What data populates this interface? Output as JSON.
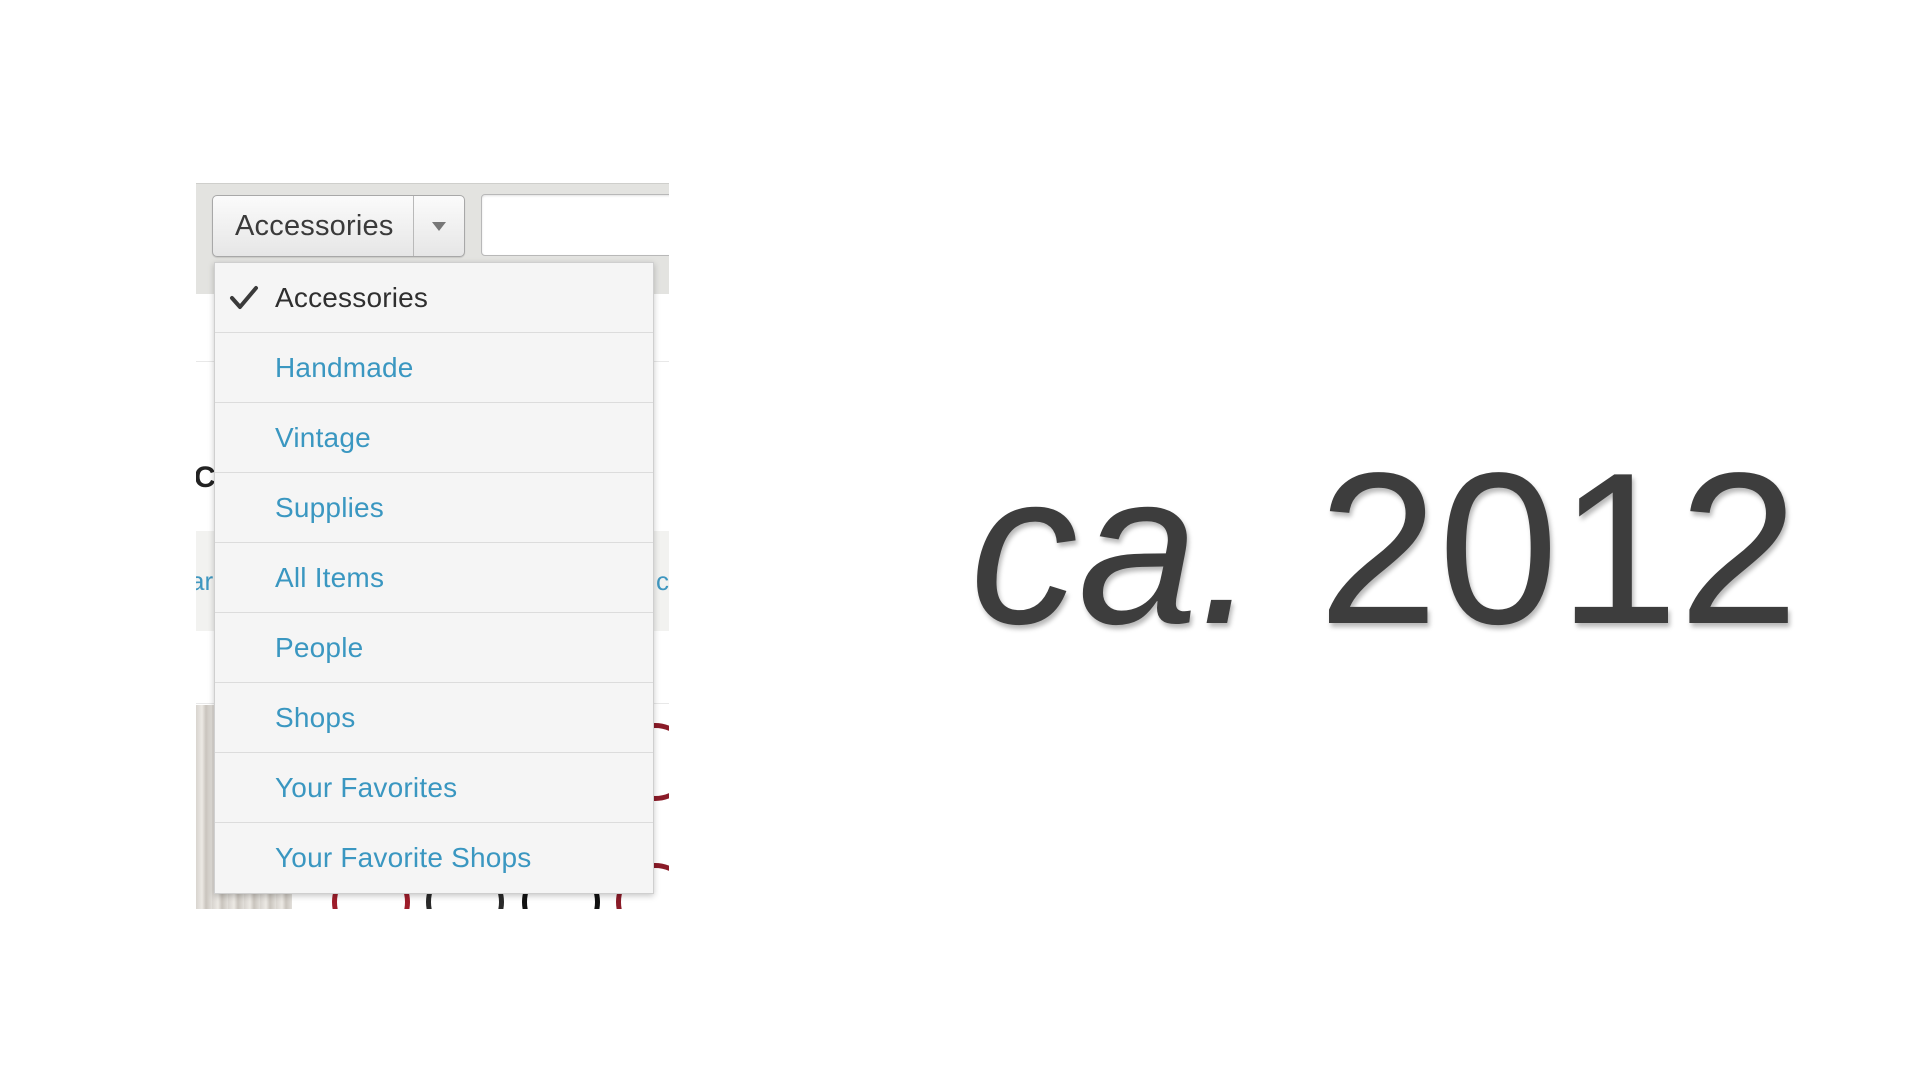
{
  "category_button": {
    "label": "Accessories",
    "arrow_icon": "chevron-down-icon"
  },
  "search": {
    "value": "",
    "placeholder": ""
  },
  "background_fragments": {
    "heading_letter": "C",
    "left_tab_text": "ar",
    "right_tab_text": "c"
  },
  "dropdown": {
    "selected_icon": "checkmark-icon",
    "items": [
      {
        "label": "Accessories",
        "selected": true
      },
      {
        "label": "Handmade",
        "selected": false
      },
      {
        "label": "Vintage",
        "selected": false
      },
      {
        "label": "Supplies",
        "selected": false
      },
      {
        "label": "All Items",
        "selected": false
      },
      {
        "label": "People",
        "selected": false
      },
      {
        "label": "Shops",
        "selected": false
      },
      {
        "label": "Your Favorites",
        "selected": false
      },
      {
        "label": "Your Favorite Shops",
        "selected": false
      }
    ]
  },
  "caption": {
    "prefix": "ca.",
    "year": "2012"
  },
  "colors": {
    "link": "#3a97c1",
    "selected_text": "#2f2f2f",
    "caption_text": "#3d3d3d",
    "toolbar_bg": "#e3e3e0",
    "menu_bg": "#f5f5f5"
  }
}
